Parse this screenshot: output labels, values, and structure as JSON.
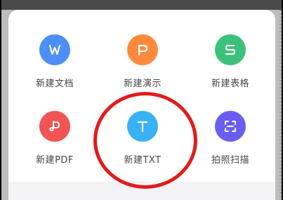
{
  "menu": {
    "items": [
      {
        "label": "新建文档",
        "icon": "word-icon",
        "color": "#4d8ef7"
      },
      {
        "label": "新建演示",
        "icon": "presentation-icon",
        "color": "#ff8a3d"
      },
      {
        "label": "新建表格",
        "icon": "spreadsheet-icon",
        "color": "#3cc17a"
      },
      {
        "label": "新建PDF",
        "icon": "pdf-icon",
        "color": "#f05454"
      },
      {
        "label": "新建TXT",
        "icon": "txt-icon",
        "color": "#39b2f5"
      },
      {
        "label": "拍照扫描",
        "icon": "scan-icon",
        "color": "#6a5ef2"
      }
    ]
  },
  "annotation": {
    "color": "#e31b1b"
  }
}
